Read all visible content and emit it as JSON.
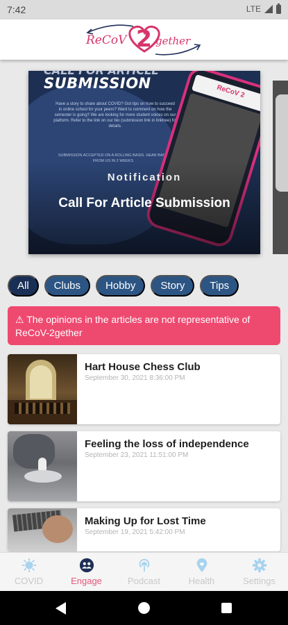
{
  "status_bar": {
    "time": "7:42",
    "network": "LTE"
  },
  "logo": {
    "left": "ReCoV",
    "middle": "2",
    "right": "gether"
  },
  "carousel": {
    "heading_top": "CALL FOR ARTICLE",
    "heading": "SUBMISSION",
    "body": "Have a story to share about COVID? Got tips on how to succeed in online school for your peers? Want to comment on how the semester is going? We are looking for more student voices on our platform. Refer to the link on our bio (submission link in linktree) for details.",
    "note": "Submission accepted on a rolling basis. Hear back from us in 2 weeks",
    "phone_logo": "ReCoV 2",
    "kicker": "Notification",
    "title": "Call For Article Submission"
  },
  "filters": [
    {
      "label": "All",
      "active": true
    },
    {
      "label": "Clubs",
      "active": false
    },
    {
      "label": "Hobby",
      "active": false
    },
    {
      "label": "Story",
      "active": false
    },
    {
      "label": "Tips",
      "active": false
    }
  ],
  "disclaimer": "⚠ The opinions in the articles are not representative of ReCoV-2gether",
  "articles": [
    {
      "title": "Hart House Chess Club",
      "date": "September 30, 2021 8:36:00 PM"
    },
    {
      "title": "Feeling the loss of independence",
      "date": "September 23, 2021 11:51:00 PM"
    },
    {
      "title": "Making Up for Lost Time",
      "date": "September 19, 2021 5:42:00 PM"
    }
  ],
  "bottom_nav": [
    {
      "label": "COVID",
      "icon": "virus-icon",
      "active": false
    },
    {
      "label": "Engage",
      "icon": "people-icon",
      "active": true
    },
    {
      "label": "Podcast",
      "icon": "podcast-icon",
      "active": false
    },
    {
      "label": "Health",
      "icon": "heart-location-icon",
      "active": false
    },
    {
      "label": "Settings",
      "icon": "gear-icon",
      "active": false
    }
  ],
  "colors": {
    "accent": "#e2577a",
    "chip": "#2c5584",
    "chip_active": "#1a2f55",
    "banner": "#ee4a70",
    "brand": "#d6356a"
  }
}
